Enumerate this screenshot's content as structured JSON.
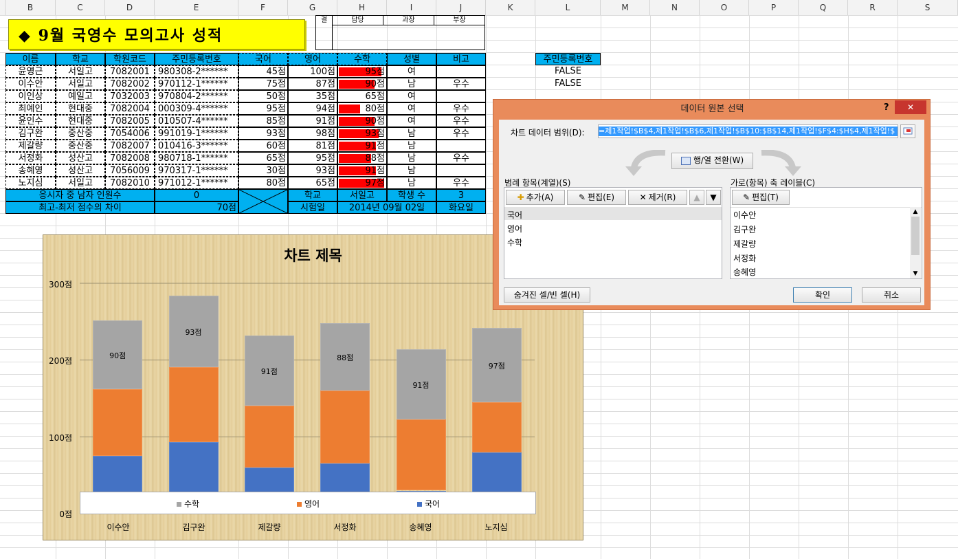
{
  "columns": [
    "B",
    "C",
    "D",
    "E",
    "F",
    "G",
    "H",
    "I",
    "J",
    "K",
    "L",
    "M",
    "N",
    "O",
    "P",
    "Q",
    "R",
    "S"
  ],
  "sheet": {
    "title": "◆  9월 국영수 모의고사 성적",
    "approval": [
      "결",
      "담당",
      "과장",
      "부장"
    ],
    "headers": [
      "이름",
      "학교",
      "학원코드",
      "주민등록번호",
      "국어",
      "영어",
      "수학",
      "성별",
      "비고"
    ],
    "rows": [
      [
        "윤영근",
        "서일고",
        "7082001",
        "980308-2******",
        "45점",
        "100점",
        "95점",
        "여",
        ""
      ],
      [
        "이수안",
        "서일고",
        "7082002",
        "970112-1******",
        "75점",
        "87점",
        "90점",
        "남",
        "우수"
      ],
      [
        "이인상",
        "예일고",
        "7032003",
        "970804-2******",
        "50점",
        "35점",
        "65점",
        "여",
        ""
      ],
      [
        "최예인",
        "현대중",
        "7082004",
        "000309-4******",
        "95점",
        "94점",
        "80점",
        "여",
        "우수"
      ],
      [
        "윤인수",
        "현대중",
        "7082005",
        "010507-4******",
        "85점",
        "91점",
        "90점",
        "여",
        "우수"
      ],
      [
        "김구완",
        "중산중",
        "7054006",
        "991019-1******",
        "93점",
        "98점",
        "93점",
        "남",
        "우수"
      ],
      [
        "제갈량",
        "중산중",
        "7082007",
        "010416-3******",
        "60점",
        "81점",
        "91점",
        "남",
        ""
      ],
      [
        "서정화",
        "성산고",
        "7082008",
        "980718-1******",
        "65점",
        "95점",
        "88점",
        "남",
        "우수"
      ],
      [
        "송혜영",
        "성산고",
        "7056009",
        "970317-1******",
        "30점",
        "93점",
        "91점",
        "남",
        ""
      ],
      [
        "노지심",
        "서일고",
        "7082010",
        "971012-1******",
        "80점",
        "65점",
        "97점",
        "남",
        "우수"
      ]
    ],
    "math_values": [
      95,
      90,
      65,
      80,
      90,
      93,
      91,
      88,
      91,
      97
    ],
    "footer1": {
      "label": "응시자 중 남자 인원수",
      "value": "0",
      "school_label": "학교",
      "school": "서일고",
      "students_label": "학생 수",
      "students": "3"
    },
    "footer2": {
      "label": "최고-최저 점수의 차이",
      "value": "70점",
      "date_label": "시험일",
      "date": "2014년 09월 02일",
      "day": "화요일"
    },
    "side_header": "주민등록번호",
    "side_values": [
      "FALSE",
      "FALSE"
    ]
  },
  "chart_data": {
    "type": "bar",
    "stacked": true,
    "title": "차트 제목",
    "categories": [
      "이수안",
      "김구완",
      "제갈량",
      "서정화",
      "송혜영",
      "노지심"
    ],
    "series": [
      {
        "name": "국어",
        "values": [
          75,
          93,
          60,
          65,
          30,
          80
        ],
        "color": "#4472c4"
      },
      {
        "name": "영어",
        "values": [
          87,
          98,
          81,
          95,
          93,
          65
        ],
        "color": "#ed7d31"
      },
      {
        "name": "수학",
        "values": [
          90,
          93,
          91,
          88,
          91,
          97
        ],
        "color": "#a5a5a5"
      }
    ],
    "data_labels_series": "수학",
    "ylim": [
      0,
      300
    ],
    "yticks": [
      "0점",
      "100점",
      "200점",
      "300점"
    ],
    "legend": [
      "수학",
      "영어",
      "국어"
    ],
    "legend_position": "bottom",
    "grid": true
  },
  "dialog": {
    "title": "데이터 원본 선택",
    "help": "?",
    "close": "✕",
    "range_label": "차트 데이터 범위(D):",
    "range_value": "=제1작업!$B$4,제1작업!$B$6,제1작업!$B$10:$B$14,제1작업!$F$4:$H$4,제1작업!$",
    "switch_button": "행/열 전환(W)",
    "legend_label": "범례 항목(계열)(S)",
    "add": "추가(A)",
    "edit": "편집(E)",
    "remove": "제거(R)",
    "series_items": [
      "국어",
      "영어",
      "수학"
    ],
    "axis_label": "가로(항목) 축 레이블(C)",
    "axis_edit": "편집(T)",
    "axis_items": [
      "이수안",
      "김구완",
      "제갈량",
      "서정화",
      "송혜영"
    ],
    "hidden_button": "숨겨진 셀/빈 셀(H)",
    "ok": "확인",
    "cancel": "취소"
  }
}
